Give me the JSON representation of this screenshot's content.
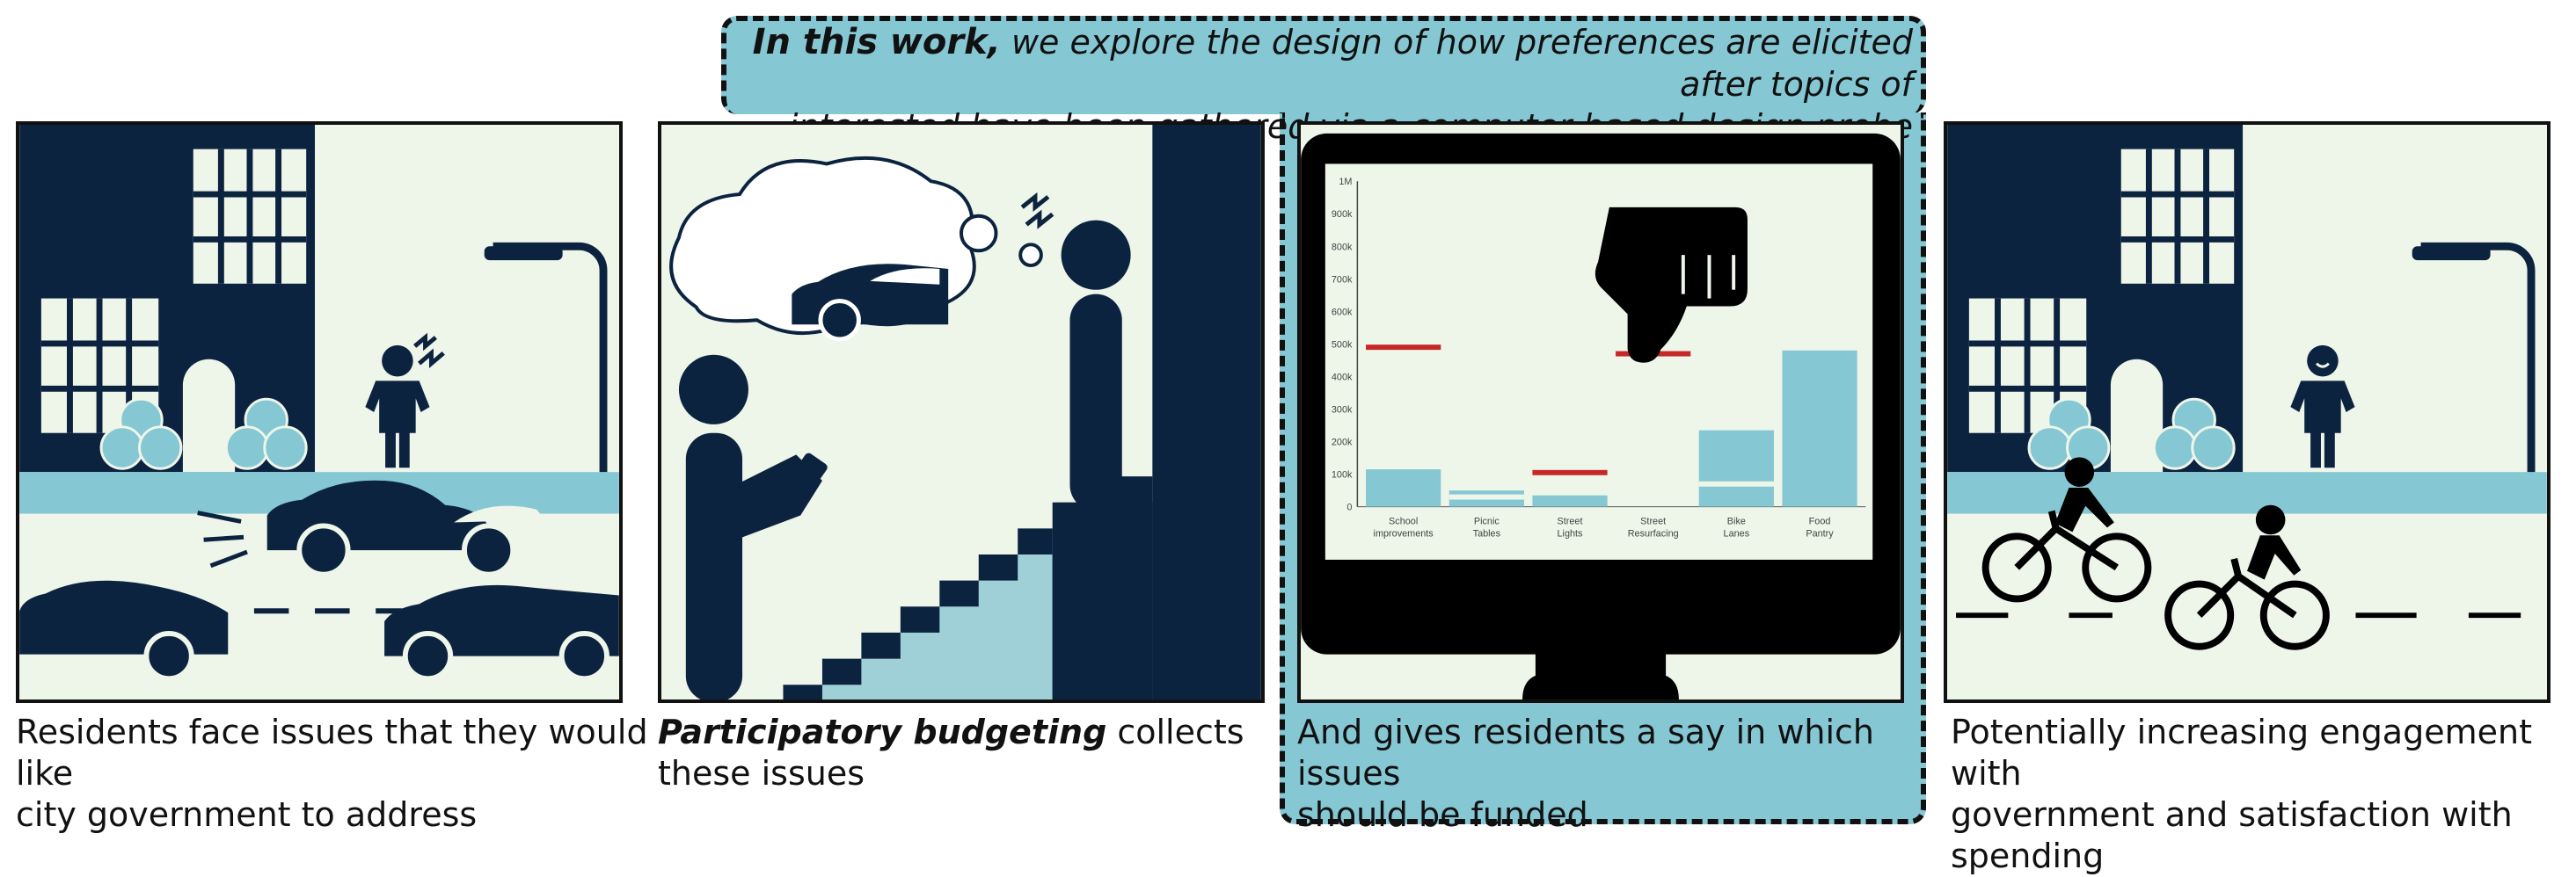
{
  "intro": {
    "bold": "In this work,",
    "line1_rest": " we explore the design of how preferences are elicited after topics of",
    "line2": "interested have been gathered via a computer based design probe"
  },
  "panels": [
    {
      "caption_line1": "Residents face issues that they would like",
      "caption_line2": "city government to address"
    },
    {
      "caption_bold": "Participatory budgeting",
      "caption_line1_rest": " collects",
      "caption_line2": "these issues"
    },
    {
      "caption_line1": "And gives residents a say in which issues",
      "caption_line2": "should be funded"
    },
    {
      "caption_line1": "Potentially increasing engagement with",
      "caption_line2": "government and satisfaction with spending"
    }
  ],
  "colors": {
    "navy": "#0c2340",
    "teal": "#86c7d4",
    "light": "#eef5e9",
    "red": "#c62828"
  },
  "chart_data": {
    "type": "bar",
    "categories": [
      "School improvements",
      "Picnic Tables",
      "Street Lights",
      "Street Resurfacing",
      "Bike Lanes",
      "Food Pantry"
    ],
    "category_lines": [
      [
        "School",
        "improvements"
      ],
      [
        "Picnic",
        "Tables"
      ],
      [
        "Street",
        "Lights"
      ],
      [
        "Street",
        "Resurfacing"
      ],
      [
        "Bike",
        "Lanes"
      ],
      [
        "Food",
        "Pantry"
      ]
    ],
    "values": [
      115000,
      50000,
      35000,
      0,
      235000,
      480000
    ],
    "markers": [
      490000,
      30000,
      105000,
      470000,
      70000,
      null
    ],
    "ylim": [
      0,
      1000000
    ],
    "yticks": [
      "0",
      "100k",
      "200k",
      "300k",
      "400k",
      "500k",
      "600k",
      "700k",
      "800k",
      "900k",
      "1M"
    ],
    "bar_color": "#86c7d4",
    "marker_color": "#c62828"
  }
}
